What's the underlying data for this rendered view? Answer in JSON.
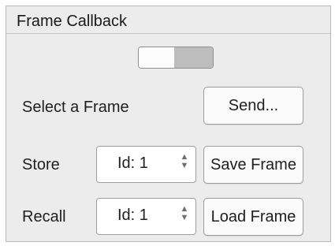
{
  "panel": {
    "title": "Frame Callback"
  },
  "toggle": {
    "state": "on"
  },
  "select_row": {
    "label": "Select a Frame",
    "button": "Send..."
  },
  "store_row": {
    "label": "Store",
    "spin_value": "Id: 1",
    "button": "Save Frame"
  },
  "recall_row": {
    "label": "Recall",
    "spin_value": "Id: 1",
    "button": "Load Frame"
  },
  "icons": {
    "spin_up": "chevron-up-icon",
    "spin_down": "chevron-down-icon"
  }
}
